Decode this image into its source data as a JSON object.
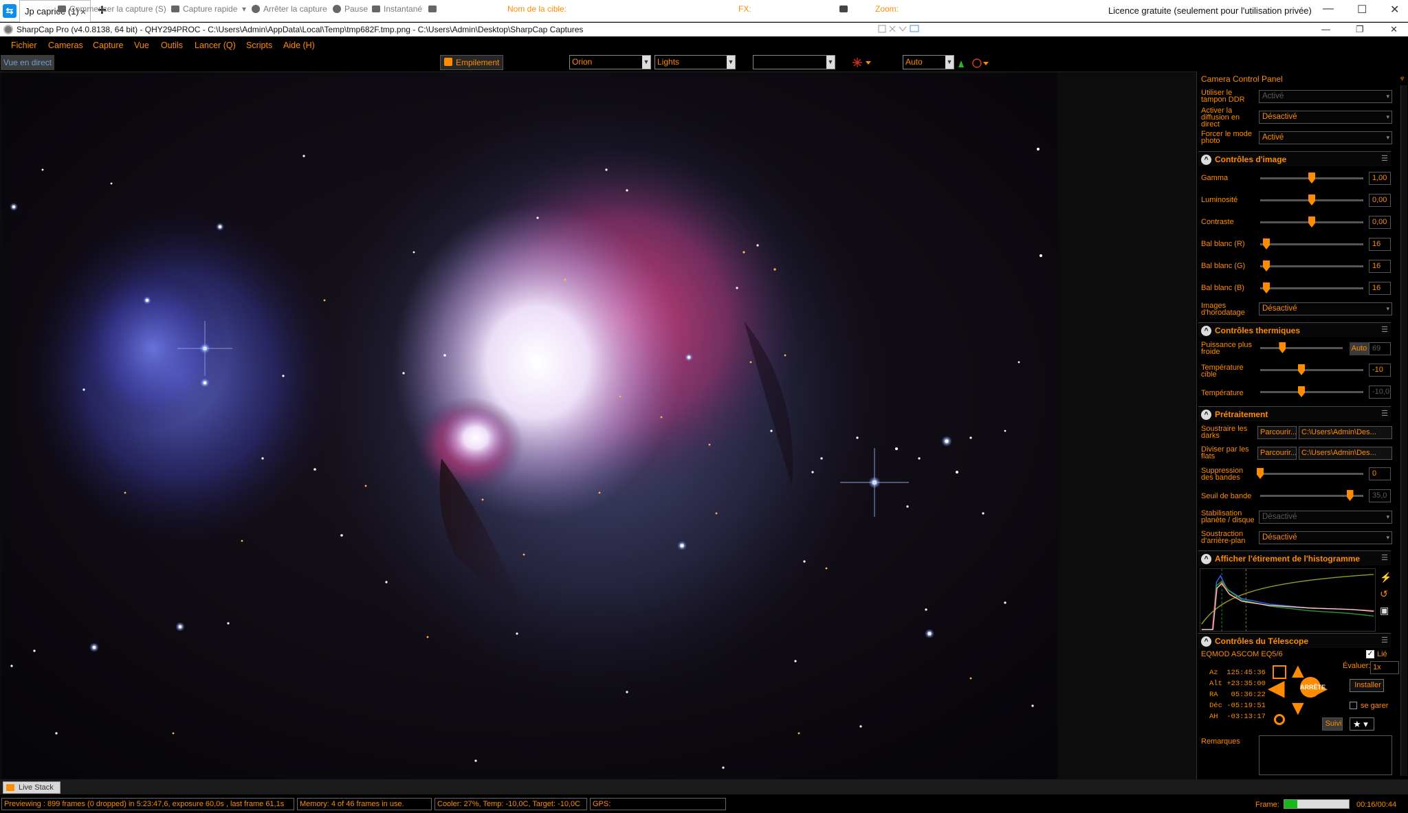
{
  "teamviewer": {
    "tab_label": "Jp caprice (1)",
    "close_glyph": "×",
    "new_tab_glyph": "+",
    "license": "Licence gratuite (seulement pour l'utilisation privée)",
    "win_min": "—",
    "win_max": "☐",
    "win_close": "✕"
  },
  "app": {
    "title": "SharpCap Pro (v4.0.8138, 64 bit) - QHY294PROC - C:\\Users\\Admin\\AppData\\Local\\Temp\\tmp682F.tmp.png - C:\\Users\\Admin\\Desktop\\SharpCap Captures",
    "win_min": "—",
    "win_restore": "❐",
    "win_close": "✕"
  },
  "menu": [
    "Fichier",
    "Cameras",
    "Capture",
    "Vue",
    "Outils",
    "Lancer (Q)",
    "Scripts",
    "Aide (H)"
  ],
  "toolbar": {
    "live_view": "Vue en direct",
    "start_capture": "Commencer la capture (S)",
    "quick_capture": "Capture rapide",
    "stop_capture": "Arrêter la capture",
    "pause": "Pause",
    "snapshot": "Instantané",
    "stacking": "Empilement",
    "target_label": "Nom de la cible:",
    "target_value": "Orion",
    "frame_type": "Lights",
    "fx_label": "FX:",
    "fx_value": "",
    "zoom_label": "Zoom:",
    "zoom_value": "Auto"
  },
  "panel": {
    "title": "Camera Control Panel",
    "pin": "ᵩ",
    "top_rows": [
      {
        "label": "Utiliser le tampon DDR",
        "value": "Activé",
        "dim": true
      },
      {
        "label": "Activer la diffusion en direct",
        "value": "Désactivé",
        "dim": false
      },
      {
        "label": "Forcer le mode photo",
        "value": "Activé",
        "dim": false
      }
    ],
    "image_controls": {
      "title": "Contrôles d'image",
      "gamma": {
        "label": "Gamma",
        "value": "1,00",
        "level": 0.5
      },
      "brightness": {
        "label": "Luminosité",
        "value": "0,00",
        "level": 0.5
      },
      "contrast": {
        "label": "Contraste",
        "value": "0,00",
        "level": 0.5
      },
      "wb_r": {
        "label": "Bal blanc (R)",
        "value": "16",
        "level": 0.06
      },
      "wb_g": {
        "label": "Bal blanc (G)",
        "value": "16",
        "level": 0.06
      },
      "wb_b": {
        "label": "Bal blanc (B)",
        "value": "16",
        "level": 0.06
      },
      "timestamp": {
        "label": "Images d'horodatage",
        "value": "Désactivé"
      }
    },
    "thermal": {
      "title": "Contrôles thermiques",
      "cooler": {
        "label": "Puissance plus froide",
        "auto": "Auto",
        "value": "69",
        "level": 0.27
      },
      "target_temp": {
        "label": "Température cible",
        "value": "-10",
        "level": 0.4
      },
      "temp": {
        "label": "Température",
        "value": "-10,0",
        "level": 0.4
      }
    },
    "preprocessing": {
      "title": "Prétraitement",
      "darks": {
        "label": "Soustraire les darks",
        "browse": "Parcourir...",
        "path": "C:\\Users\\Admin\\Des..."
      },
      "flats": {
        "label": "Diviser par les flats",
        "browse": "Parcourir...",
        "path": "C:\\Users\\Admin\\Des..."
      },
      "banding": {
        "label": "Suppression des bandes",
        "value": "0",
        "level": 0.0
      },
      "band_threshold": {
        "label": "Seuil de bande",
        "value": "35,0",
        "level": 0.87
      },
      "stabilization": {
        "label": "Stabilisation planète / disque",
        "value": "Désactivé"
      },
      "bg_subtraction": {
        "label": "Soustraction d'arrière-plan",
        "value": "Désactivé"
      }
    },
    "histogram": {
      "title": "Afficher l'étirement de l'histogramme"
    },
    "telescope": {
      "title": "Contrôles du Télescope",
      "mount": "EQMOD ASCOM EQ5/6",
      "linked": "Lié",
      "az": {
        "label": "Az",
        "value": "125:45:36"
      },
      "alt": {
        "label": "Alt",
        "value": "+23:35:00"
      },
      "ra": {
        "label": "RA",
        "value": "05:36:22"
      },
      "dec": {
        "label": "Déc",
        "value": "-05:19:51"
      },
      "ha": {
        "label": "AH",
        "value": "-03:13:17"
      },
      "rate_label": "Évaluer:",
      "rate_value": "1x",
      "install": "Installer",
      "park": "se garer",
      "track": "Suivi",
      "stop": "ARRÊTE"
    },
    "notes": {
      "label": "Remarques"
    }
  },
  "bottom_tab": "Live Stack",
  "status": {
    "preview": "Previewing : 899 frames (0 dropped) in 5:23:47,6, exposure 60,0s , last frame 61,1s",
    "memory": "Memory: 4 of 46 frames in use.",
    "cooler": "Cooler: 27%, Temp: -10,0C, Target: -10,0C",
    "gps": "GPS:",
    "frame_label": "Frame:",
    "frame_progress": 0.2,
    "time": "00:16/00:44"
  },
  "colors": {
    "accent": "#ff8c00",
    "live": "#6f9fd8"
  }
}
